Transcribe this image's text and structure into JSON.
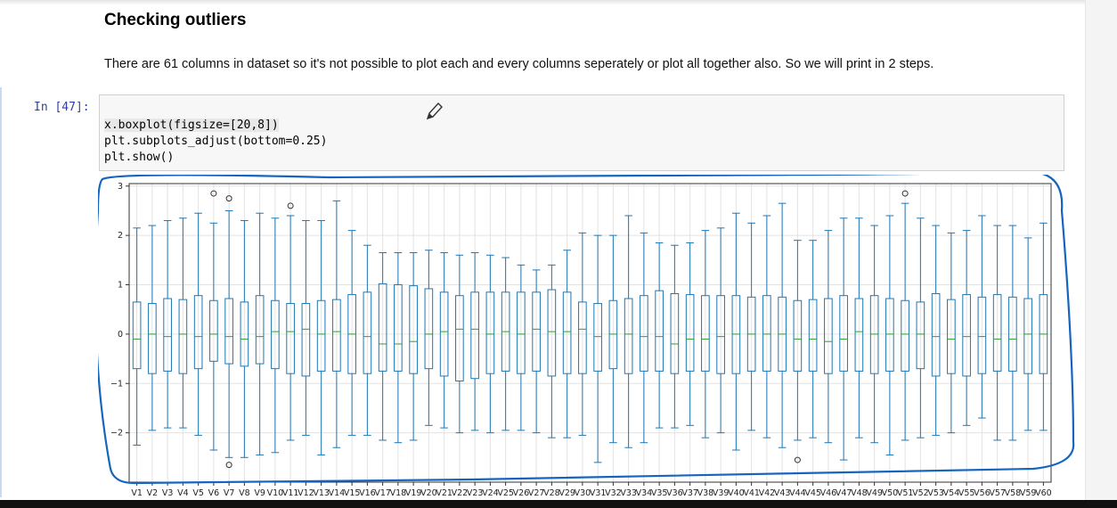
{
  "section": {
    "title": "Checking outliers",
    "description": "There are 61 columns in dataset so it's not possible to plot each and every columns seperately or plot all together also. So we will print in 2 steps."
  },
  "cell": {
    "prompt": "In [47]:",
    "code_lines": [
      "x.boxplot(figsize=[20,8])",
      "plt.subplots_adjust(bottom=0.25)",
      "plt.show()"
    ]
  },
  "icons": {
    "cursor": "pencil-cursor-icon"
  },
  "colors": {
    "prompt": "#303f9f",
    "box": "#1f77b4",
    "median": "#2ca02c",
    "annotation": "#1565c0"
  },
  "chart_data": {
    "type": "boxplot",
    "categories": [
      "V1",
      "V2",
      "V3",
      "V4",
      "V5",
      "V6",
      "V7",
      "V8",
      "V9",
      "V10",
      "V11",
      "V12",
      "V13",
      "V14",
      "V15",
      "V16",
      "V17",
      "V18",
      "V19",
      "V20",
      "V21",
      "V22",
      "V23",
      "V24",
      "V25",
      "V26",
      "V27",
      "V28",
      "V29",
      "V30",
      "V31",
      "V32",
      "V33",
      "V34",
      "V35",
      "V36",
      "V37",
      "V38",
      "V39",
      "V40",
      "V41",
      "V42",
      "V43",
      "V44",
      "V45",
      "V46",
      "V47",
      "V48",
      "V49",
      "V50",
      "V51",
      "V52",
      "V53",
      "V54",
      "V55",
      "V56",
      "V57",
      "V58",
      "V59",
      "V60"
    ],
    "q1": [
      -0.7,
      -0.8,
      -0.75,
      -0.8,
      -0.7,
      -0.55,
      -0.6,
      -0.65,
      -0.6,
      -0.7,
      -0.8,
      -0.85,
      -0.75,
      -0.75,
      -0.8,
      -0.8,
      -0.75,
      -0.75,
      -0.8,
      -0.7,
      -0.85,
      -0.95,
      -0.9,
      -0.8,
      -0.75,
      -0.8,
      -0.75,
      -0.85,
      -0.8,
      -0.8,
      -0.75,
      -0.7,
      -0.8,
      -0.75,
      -0.75,
      -0.8,
      -0.75,
      -0.75,
      -0.8,
      -0.8,
      -0.75,
      -0.75,
      -0.75,
      -0.75,
      -0.75,
      -0.8,
      -0.75,
      -0.75,
      -0.8,
      -0.75,
      -0.75,
      -0.7,
      -0.85,
      -0.8,
      -0.85,
      -0.8,
      -0.75,
      -0.75,
      -0.8,
      -0.8
    ],
    "median": [
      -0.1,
      0.0,
      -0.05,
      0.0,
      -0.05,
      0.0,
      -0.05,
      -0.1,
      -0.05,
      0.05,
      0.05,
      0.1,
      0.0,
      0.05,
      0.0,
      -0.05,
      -0.2,
      -0.2,
      -0.15,
      0.0,
      0.05,
      0.1,
      0.1,
      0.0,
      0.05,
      0.0,
      0.1,
      0.05,
      0.05,
      0.1,
      -0.05,
      0.0,
      0.0,
      -0.05,
      -0.05,
      -0.2,
      -0.1,
      -0.1,
      -0.05,
      0.0,
      0.0,
      0.0,
      0.0,
      -0.1,
      -0.1,
      -0.15,
      -0.1,
      0.05,
      0.0,
      0.0,
      0.0,
      0.0,
      -0.05,
      -0.1,
      -0.05,
      -0.05,
      -0.1,
      -0.1,
      0.0,
      0.0
    ],
    "q3": [
      0.65,
      0.62,
      0.72,
      0.7,
      0.78,
      0.68,
      0.72,
      0.65,
      0.78,
      0.68,
      0.62,
      0.62,
      0.68,
      0.7,
      0.8,
      0.85,
      1.02,
      1.0,
      0.98,
      0.92,
      0.85,
      0.78,
      0.85,
      0.85,
      0.85,
      0.85,
      0.85,
      0.9,
      0.85,
      0.65,
      0.62,
      0.68,
      0.72,
      0.78,
      0.88,
      0.82,
      0.8,
      0.78,
      0.78,
      0.78,
      0.75,
      0.78,
      0.75,
      0.68,
      0.7,
      0.72,
      0.78,
      0.72,
      0.78,
      0.72,
      0.68,
      0.65,
      0.82,
      0.7,
      0.8,
      0.75,
      0.8,
      0.75,
      0.72,
      0.8
    ],
    "whisker_low": [
      -2.25,
      -1.95,
      -1.9,
      -1.9,
      -2.05,
      -2.35,
      -2.5,
      -2.5,
      -2.45,
      -2.4,
      -2.15,
      -2.05,
      -2.45,
      -2.3,
      -2.05,
      -2.05,
      -2.15,
      -2.2,
      -2.15,
      -1.85,
      -1.9,
      -2.0,
      -1.95,
      -2.0,
      -1.95,
      -1.95,
      -2.0,
      -2.1,
      -2.1,
      -2.05,
      -2.6,
      -2.2,
      -2.3,
      -2.2,
      -1.9,
      -1.9,
      -1.85,
      -2.1,
      -2.0,
      -2.35,
      -1.95,
      -2.1,
      -2.3,
      -2.15,
      -2.1,
      -2.2,
      -2.55,
      -2.1,
      -2.2,
      -2.45,
      -2.15,
      -2.1,
      -2.05,
      -2.0,
      -1.85,
      -1.7,
      -2.15,
      -2.15,
      -1.95,
      -1.95
    ],
    "whisker_high": [
      2.15,
      2.2,
      2.3,
      2.35,
      2.45,
      2.25,
      2.5,
      2.3,
      2.45,
      2.35,
      2.4,
      2.3,
      2.3,
      2.7,
      2.1,
      1.8,
      1.65,
      1.65,
      1.65,
      1.7,
      1.65,
      1.6,
      1.65,
      1.6,
      1.55,
      1.4,
      1.3,
      1.4,
      1.7,
      2.05,
      2.0,
      2.0,
      2.4,
      2.05,
      1.85,
      1.8,
      1.85,
      2.1,
      2.15,
      2.45,
      2.25,
      2.4,
      2.65,
      1.9,
      1.9,
      2.1,
      2.35,
      2.35,
      2.2,
      2.4,
      2.65,
      2.35,
      2.2,
      2.05,
      2.1,
      2.4,
      2.2,
      2.2,
      1.95,
      2.25
    ],
    "outliers": [
      [],
      [],
      [],
      [],
      [],
      [
        2.85
      ],
      [
        -2.65,
        2.75
      ],
      [],
      [],
      [],
      [
        2.6
      ],
      [],
      [],
      [],
      [],
      [],
      [],
      [],
      [],
      [],
      [],
      [],
      [],
      [],
      [],
      [],
      [],
      [],
      [],
      [],
      [],
      [],
      [],
      [],
      [],
      [],
      [],
      [],
      [],
      [],
      [],
      [],
      [],
      [
        -2.55
      ],
      [],
      [],
      [],
      [],
      [],
      [],
      [
        2.85
      ],
      [],
      [],
      [],
      [],
      [],
      [],
      [],
      [],
      []
    ],
    "ylim": [
      -3.0,
      3.05
    ],
    "yticks": [
      -2,
      -1,
      0,
      1,
      2,
      3
    ],
    "ytick_labels": [
      "−2",
      "−1",
      "0",
      "1",
      "2",
      "3"
    ],
    "grid": true
  }
}
